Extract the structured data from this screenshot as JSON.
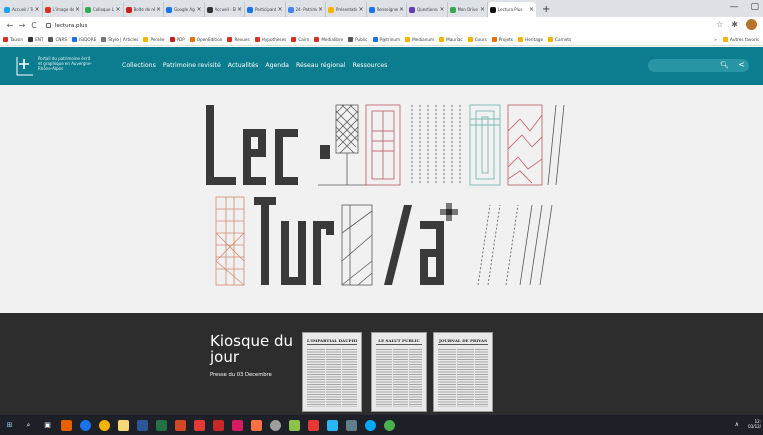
{
  "browser": {
    "tabs": [
      {
        "label": "Accueil / Tw",
        "color": "#1da1f2"
      },
      {
        "label": "L'image de l",
        "color": "#d93025"
      },
      {
        "label": "Colloque Le",
        "color": "#34a853"
      },
      {
        "label": "Boîte de ré",
        "color": "#c5221f"
      },
      {
        "label": "Google Agen",
        "color": "#1a73e8"
      },
      {
        "label": "Accueil - ENT",
        "color": "#333333"
      },
      {
        "label": "Participants",
        "color": "#1a73e8"
      },
      {
        "label": "24- Patrimo",
        "color": "#4285f4"
      },
      {
        "label": "Présentation",
        "color": "#f4b400"
      },
      {
        "label": "Renseigneme",
        "color": "#1a73e8"
      },
      {
        "label": "Questionnai",
        "color": "#673ab7"
      },
      {
        "label": "Mon Drive",
        "color": "#34a853"
      },
      {
        "label": "Lectura Plus",
        "color": "#111111"
      }
    ],
    "new_tab": "+",
    "window_controls": [
      "—",
      "▢"
    ],
    "address": "lectura.plus",
    "nav": {
      "back": "←",
      "forward": "→",
      "reload": "C"
    },
    "addr_icons": [
      "☆",
      "✱"
    ]
  },
  "bookmarks": {
    "items": [
      {
        "label": "Tausin",
        "color": "#d93025"
      },
      {
        "label": "ENT",
        "color": "#333333"
      },
      {
        "label": "CNRS",
        "color": "#555555"
      },
      {
        "label": "ISIDORE",
        "color": "#1a73e8"
      },
      {
        "label": "Stylo | Articles",
        "color": "#777777"
      },
      {
        "label": "Persée",
        "color": "#f4b400"
      },
      {
        "label": "PDP",
        "color": "#c5221f"
      },
      {
        "label": "OpenEdition",
        "color": "#e8710a"
      },
      {
        "label": "Revues",
        "color": "#d93025"
      },
      {
        "label": "Hypothèses",
        "color": "#d93025"
      },
      {
        "label": "Cairn",
        "color": "#d93025"
      },
      {
        "label": "Medialibre",
        "color": "#d93025"
      },
      {
        "label": "Public",
        "color": "#555555"
      },
      {
        "label": "P@trinum",
        "color": "#1a73e8"
      },
      {
        "label": "Medianum",
        "color": "#f4b400"
      },
      {
        "label": "Mauriac",
        "color": "#f4b400"
      },
      {
        "label": "Cours",
        "color": "#f4b400"
      },
      {
        "label": "Projets",
        "color": "#e8710a"
      },
      {
        "label": "Heritage",
        "color": "#f4b400"
      },
      {
        "label": "Carnets",
        "color": "#f4b400"
      }
    ],
    "more": "»",
    "other": "Autres favoris"
  },
  "site": {
    "portal_text": "Portail du patrimoine écrit et graphique en Auvergne-Rhône-Alpes",
    "nav": [
      "Collections",
      "Patrimoine revisité",
      "Actualités",
      "Agenda",
      "Réseau régional",
      "Ressources"
    ],
    "search_icon": "search-icon",
    "share_icon": "share-icon",
    "header_color": "#0c7d8e"
  },
  "kiosque": {
    "title": "Kiosque du jour",
    "subtitle": "Presse du 03 Decembre",
    "papers": [
      {
        "masthead": "L'IMPARTIAL DAUPHINOIS"
      },
      {
        "masthead": "LE SALUT PUBLIC"
      },
      {
        "masthead": "JOURNAL DE PRIVAS"
      }
    ]
  },
  "taskbar": {
    "time": "12:",
    "date": "03/12/"
  }
}
